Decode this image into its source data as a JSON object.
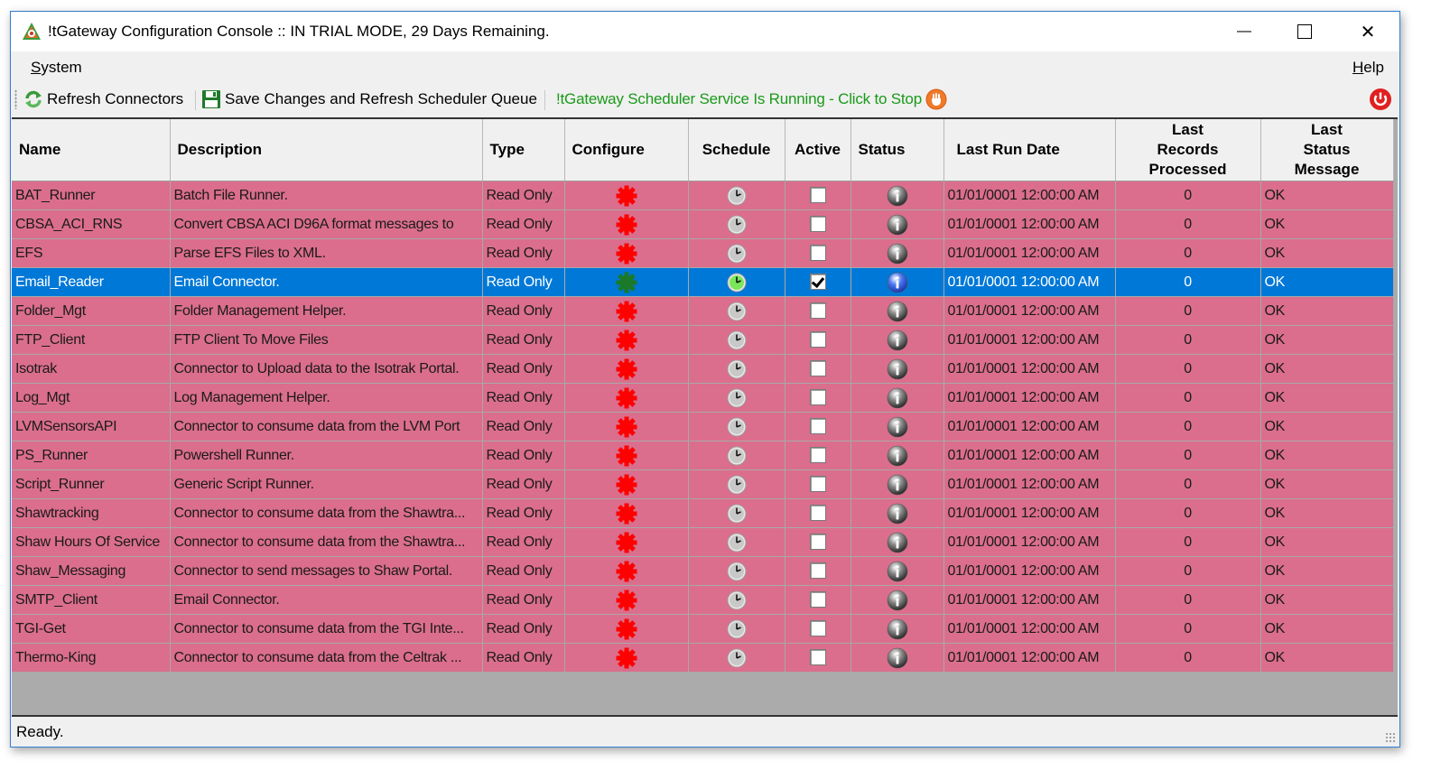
{
  "window": {
    "title": "!tGateway Configuration Console :: IN TRIAL MODE, 29 Days Remaining.",
    "controls": {
      "minimize": "—",
      "maximize": "☐",
      "close": "✕"
    }
  },
  "menu": {
    "items": [
      {
        "label_first": "S",
        "label_rest": "ystem"
      },
      {
        "label_first": "H",
        "label_rest": "elp"
      }
    ]
  },
  "toolbar": {
    "refresh_label": "Refresh Connectors",
    "save_label": "Save Changes and Refresh Scheduler Queue",
    "service_label": "!tGateway Scheduler Service Is Running - Click to Stop",
    "colors": {
      "service_text": "#1a9a1a",
      "stop": "#e8372c"
    }
  },
  "grid": {
    "columns": [
      "Name",
      "Description",
      "Type",
      "Configure",
      "Schedule",
      "Active",
      "Status",
      "Last Run Date",
      "Last Records Processed",
      "Last Status Message"
    ],
    "column_header_lines": {
      "records": [
        "Last",
        "Records",
        "Processed"
      ],
      "message": [
        "Last",
        "Status",
        "Message"
      ]
    },
    "colors": {
      "row_bg": "#db6e8d",
      "selected_bg": "#0078d7",
      "gear_inactive": "#ff0000",
      "gear_active": "#1a7a2a",
      "empty_area": "#ababab"
    },
    "rows": [
      {
        "name": "BAT_Runner",
        "description": "Batch File Runner.",
        "type": "Read Only",
        "active": false,
        "last_run": "01/01/0001 12:00:00 AM",
        "records": "0",
        "message": "OK",
        "selected": false
      },
      {
        "name": "CBSA_ACI_RNS",
        "description": "Convert CBSA ACI D96A format messages to",
        "type": "Read Only",
        "active": false,
        "last_run": "01/01/0001 12:00:00 AM",
        "records": "0",
        "message": "OK",
        "selected": false
      },
      {
        "name": "EFS",
        "description": "Parse EFS Files to XML.",
        "type": "Read Only",
        "active": false,
        "last_run": "01/01/0001 12:00:00 AM",
        "records": "0",
        "message": "OK",
        "selected": false
      },
      {
        "name": "Email_Reader",
        "description": "Email Connector.",
        "type": "Read Only",
        "active": true,
        "last_run": "01/01/0001 12:00:00 AM",
        "records": "0",
        "message": "OK",
        "selected": true
      },
      {
        "name": "Folder_Mgt",
        "description": "Folder Management Helper.",
        "type": "Read Only",
        "active": false,
        "last_run": "01/01/0001 12:00:00 AM",
        "records": "0",
        "message": "OK",
        "selected": false
      },
      {
        "name": "FTP_Client",
        "description": "FTP Client To Move Files",
        "type": "Read Only",
        "active": false,
        "last_run": "01/01/0001 12:00:00 AM",
        "records": "0",
        "message": "OK",
        "selected": false
      },
      {
        "name": "Isotrak",
        "description": "Connector to Upload data to the Isotrak Portal.",
        "type": "Read Only",
        "active": false,
        "last_run": "01/01/0001 12:00:00 AM",
        "records": "0",
        "message": "OK",
        "selected": false
      },
      {
        "name": "Log_Mgt",
        "description": "Log Management Helper.",
        "type": "Read Only",
        "active": false,
        "last_run": "01/01/0001 12:00:00 AM",
        "records": "0",
        "message": "OK",
        "selected": false
      },
      {
        "name": "LVMSensorsAPI",
        "description": "Connector to consume data from the LVM Port",
        "type": "Read Only",
        "active": false,
        "last_run": "01/01/0001 12:00:00 AM",
        "records": "0",
        "message": "OK",
        "selected": false
      },
      {
        "name": "PS_Runner",
        "description": "Powershell Runner.",
        "type": "Read Only",
        "active": false,
        "last_run": "01/01/0001 12:00:00 AM",
        "records": "0",
        "message": "OK",
        "selected": false
      },
      {
        "name": "Script_Runner",
        "description": "Generic Script Runner.",
        "type": "Read Only",
        "active": false,
        "last_run": "01/01/0001 12:00:00 AM",
        "records": "0",
        "message": "OK",
        "selected": false
      },
      {
        "name": "Shawtracking",
        "description": "Connector to consume data from the Shawtra...",
        "type": "Read Only",
        "active": false,
        "last_run": "01/01/0001 12:00:00 AM",
        "records": "0",
        "message": "OK",
        "selected": false
      },
      {
        "name": "Shaw Hours Of Service",
        "description": "Connector to consume data from the Shawtra...",
        "type": "Read Only",
        "active": false,
        "last_run": "01/01/0001 12:00:00 AM",
        "records": "0",
        "message": "OK",
        "selected": false
      },
      {
        "name": "Shaw_Messaging",
        "description": "Connector to send messages to Shaw Portal.",
        "type": "Read Only",
        "active": false,
        "last_run": "01/01/0001 12:00:00 AM",
        "records": "0",
        "message": "OK",
        "selected": false
      },
      {
        "name": "SMTP_Client",
        "description": "Email Connector.",
        "type": "Read Only",
        "active": false,
        "last_run": "01/01/0001 12:00:00 AM",
        "records": "0",
        "message": "OK",
        "selected": false
      },
      {
        "name": "TGI-Get",
        "description": "Connector to consume data from the TGI Inte...",
        "type": "Read Only",
        "active": false,
        "last_run": "01/01/0001 12:00:00 AM",
        "records": "0",
        "message": "OK",
        "selected": false
      },
      {
        "name": "Thermo-King",
        "description": "Connector to consume data from the Celtrak ...",
        "type": "Read Only",
        "active": false,
        "last_run": "01/01/0001 12:00:00 AM",
        "records": "0",
        "message": "OK",
        "selected": false
      }
    ]
  },
  "statusbar": {
    "text": "Ready."
  }
}
